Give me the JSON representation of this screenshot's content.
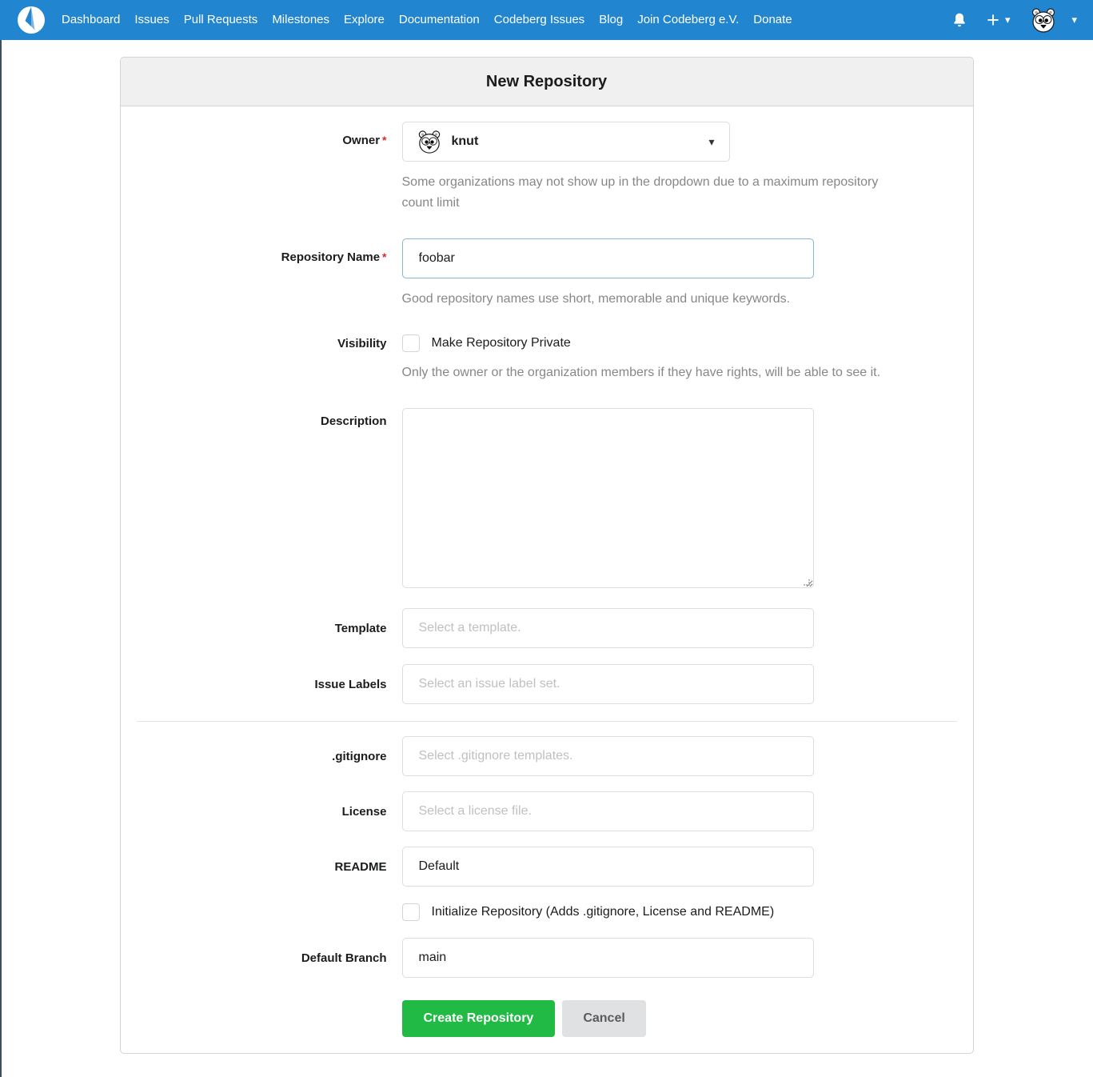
{
  "navbar": {
    "items": [
      "Dashboard",
      "Issues",
      "Pull Requests",
      "Milestones",
      "Explore",
      "Documentation",
      "Codeberg Issues",
      "Blog",
      "Join Codeberg e.V.",
      "Donate"
    ],
    "icons": {
      "bell": "bell-icon",
      "plus": "+",
      "caret": "▾"
    }
  },
  "page": {
    "title": "New Repository"
  },
  "form": {
    "owner": {
      "label": "Owner",
      "required": "*",
      "value": "knut",
      "caret": "▾",
      "help": "Some organizations may not show up in the dropdown due to a maximum repository count limit"
    },
    "repo_name": {
      "label": "Repository Name",
      "required": "*",
      "value": "foobar",
      "help": "Good repository names use short, memorable and unique keywords."
    },
    "visibility": {
      "label": "Visibility",
      "checkbox_label": "Make Repository Private",
      "checked": false,
      "help": "Only the owner or the organization members if they have rights, will be able to see it."
    },
    "description": {
      "label": "Description",
      "value": ""
    },
    "template": {
      "label": "Template",
      "placeholder": "Select a template."
    },
    "issue_labels": {
      "label": "Issue Labels",
      "placeholder": "Select an issue label set."
    },
    "gitignore": {
      "label": ".gitignore",
      "placeholder": "Select .gitignore templates."
    },
    "license": {
      "label": "License",
      "placeholder": "Select a license file."
    },
    "readme": {
      "label": "README",
      "value": "Default"
    },
    "init": {
      "checkbox_label": "Initialize Repository (Adds .gitignore, License and README)",
      "checked": false
    },
    "default_branch": {
      "label": "Default Branch",
      "value": "main"
    },
    "buttons": {
      "create": "Create Repository",
      "cancel": "Cancel"
    }
  },
  "colors": {
    "navbar_blue": "#2185D0",
    "button_green": "#21BA45",
    "required_red": "#DB2828",
    "focus_border": "#85B7D9",
    "header_gray": "#F0F0F0"
  }
}
